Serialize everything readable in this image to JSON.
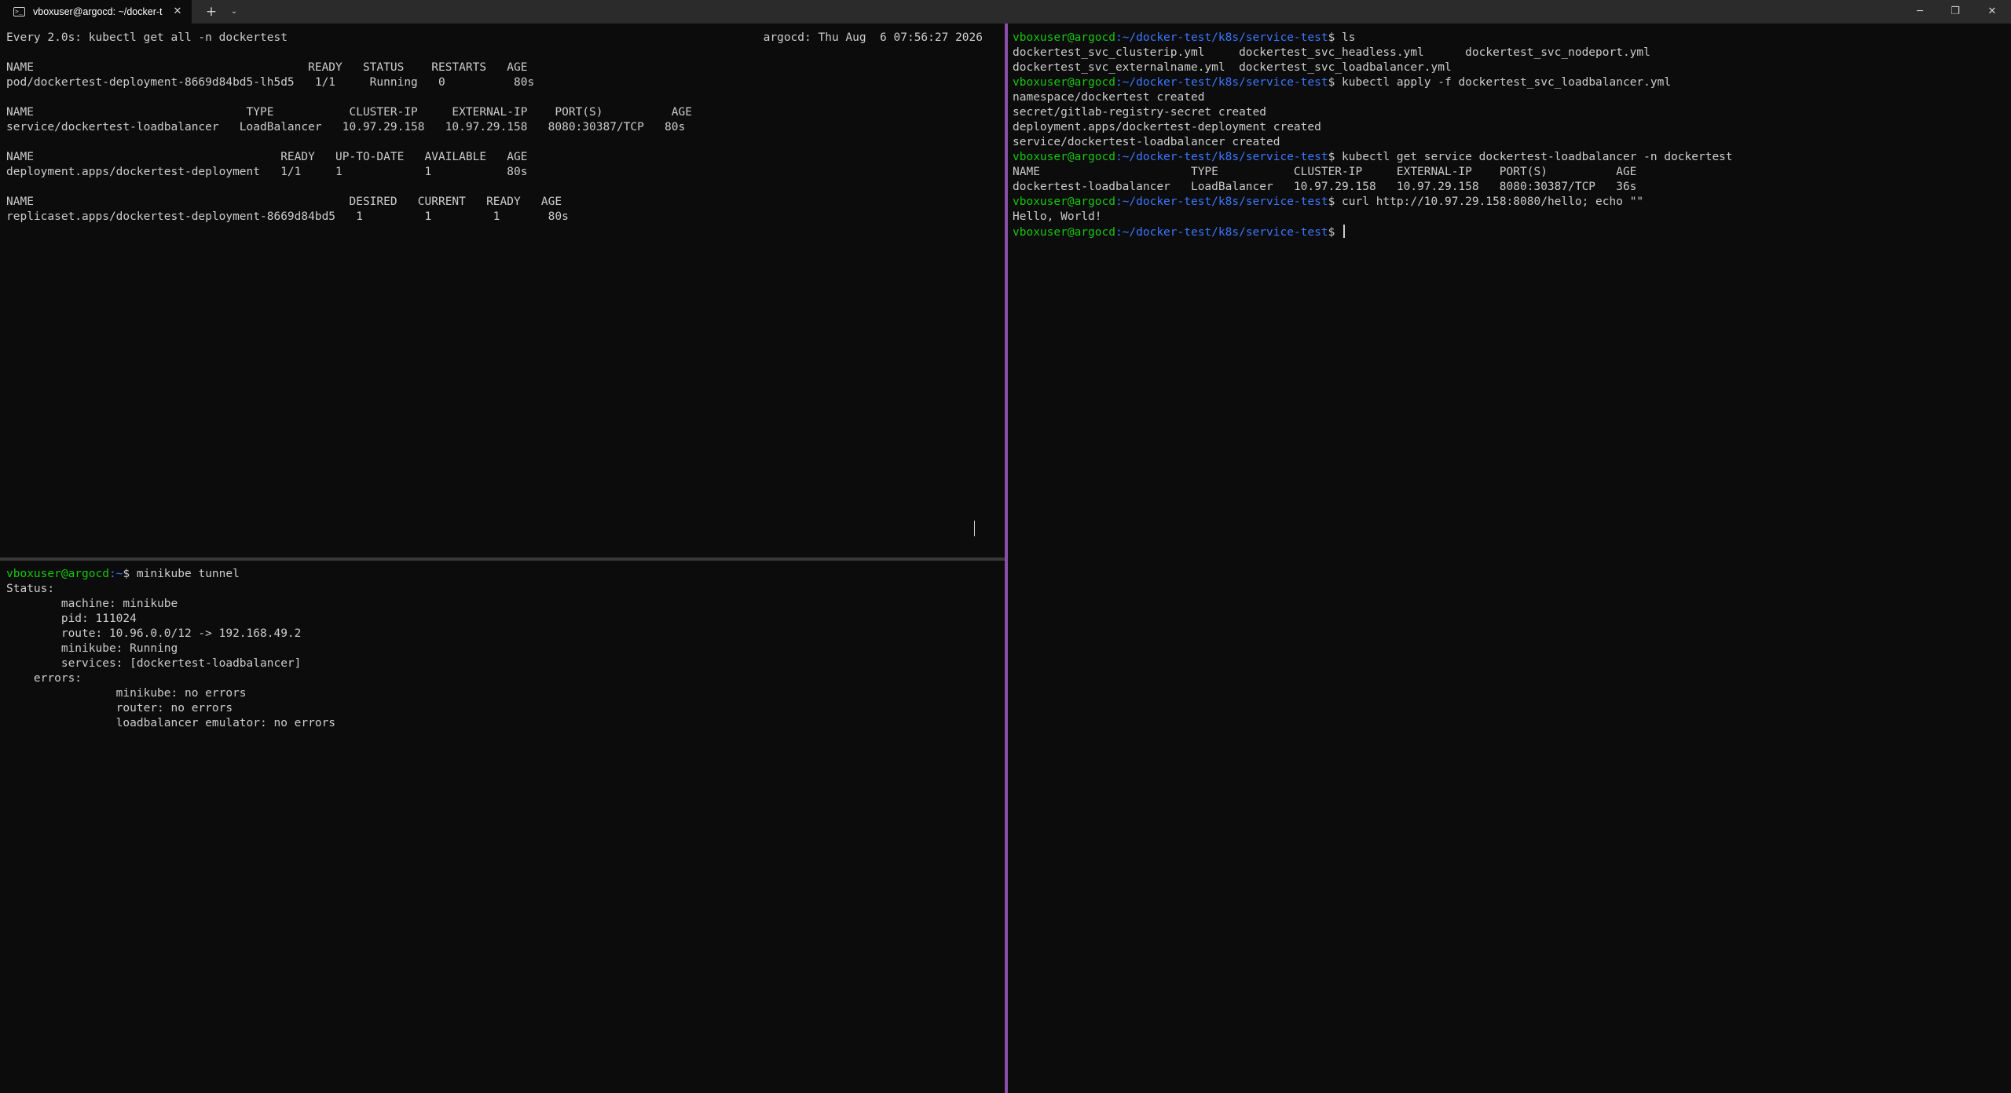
{
  "window": {
    "tab_title": "vboxuser@argocd: ~/docker-t",
    "tab_icon": "terminal-icon",
    "buttons": {
      "close_tab": "✕",
      "new_tab": "+",
      "dropdown": "⌄",
      "minimize": "─",
      "maximize": "❐",
      "close": "✕"
    }
  },
  "colors": {
    "background": "#0c0c0c",
    "text": "#cccccc",
    "prompt_user": "#16c60c",
    "prompt_path": "#3b78ff",
    "pane_divider_active": "#8a4ca8"
  },
  "watch_pane": {
    "header": "Every 2.0s: kubectl get all -n dockertest",
    "clock": "argocd: Thu Aug  6 07:56:27 2026",
    "lines": [
      "NAME                                        READY   STATUS    RESTARTS   AGE",
      "pod/dockertest-deployment-8669d84bd5-lh5d5   1/1     Running   0          80s",
      "",
      "NAME                               TYPE           CLUSTER-IP     EXTERNAL-IP    PORT(S)          AGE",
      "service/dockertest-loadbalancer   LoadBalancer   10.97.29.158   10.97.29.158   8080:30387/TCP   80s",
      "",
      "NAME                                    READY   UP-TO-DATE   AVAILABLE   AGE",
      "deployment.apps/dockertest-deployment   1/1     1            1           80s",
      "",
      "NAME                                              DESIRED   CURRENT   READY   AGE",
      "replicaset.apps/dockertest-deployment-8669d84bd5   1         1         1       80s"
    ]
  },
  "tunnel_pane": {
    "prompt_user": "vboxuser@argocd",
    "prompt_path": ":~",
    "prompt_symbol": "$ ",
    "command": "minikube tunnel",
    "lines": [
      "Status:",
      "        machine: minikube",
      "        pid: 111024",
      "        route: 10.96.0.0/12 -> 192.168.49.2",
      "        minikube: Running",
      "        services: [dockertest-loadbalancer]",
      "    errors:",
      "                minikube: no errors",
      "                router: no errors",
      "                loadbalancer emulator: no errors"
    ]
  },
  "shell_pane": {
    "prompt_user": "vboxuser@argocd",
    "prompt_path": ":~/docker-test/k8s/service-test",
    "prompt_symbol": "$ ",
    "commands": [
      "ls",
      "kubectl apply -f dockertest_svc_loadbalancer.yml",
      "kubectl get service dockertest-loadbalancer -n dockertest",
      "curl http://10.97.29.158:8080/hello; echo \"\"",
      ""
    ],
    "outputs": [
      [
        "dockertest_svc_clusterip.yml     dockertest_svc_headless.yml      dockertest_svc_nodeport.yml",
        "dockertest_svc_externalname.yml  dockertest_svc_loadbalancer.yml"
      ],
      [
        "namespace/dockertest created",
        "secret/gitlab-registry-secret created",
        "deployment.apps/dockertest-deployment created",
        "service/dockertest-loadbalancer created"
      ],
      [
        "NAME                      TYPE           CLUSTER-IP     EXTERNAL-IP    PORT(S)          AGE",
        "dockertest-loadbalancer   LoadBalancer   10.97.29.158   10.97.29.158   8080:30387/TCP   36s"
      ],
      [
        "Hello, World!"
      ]
    ]
  }
}
